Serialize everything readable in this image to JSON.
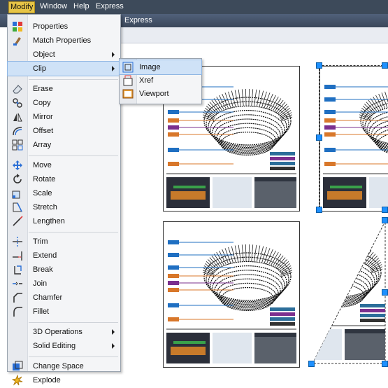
{
  "menubar": {
    "items": [
      {
        "label": "Modify"
      },
      {
        "label": "Window"
      },
      {
        "label": "Help"
      },
      {
        "label": "Express"
      }
    ]
  },
  "ribbon": {
    "tab_label": "Express"
  },
  "modify_menu": {
    "items": [
      {
        "label": "Properties",
        "icon": "properties-icon"
      },
      {
        "label": "Match Properties",
        "icon": "match-properties-icon"
      },
      {
        "label": "Object",
        "icon": "",
        "submenu": true
      },
      {
        "label": "Clip",
        "icon": "",
        "submenu": true,
        "highlighted": true
      },
      {
        "label": "Erase",
        "icon": "eraser-icon"
      },
      {
        "label": "Copy",
        "icon": "copy-icon"
      },
      {
        "label": "Mirror",
        "icon": "mirror-icon"
      },
      {
        "label": "Offset",
        "icon": "offset-icon"
      },
      {
        "label": "Array",
        "icon": "array-icon"
      },
      {
        "label": "Move",
        "icon": "move-icon"
      },
      {
        "label": "Rotate",
        "icon": "rotate-icon"
      },
      {
        "label": "Scale",
        "icon": "scale-icon"
      },
      {
        "label": "Stretch",
        "icon": "stretch-icon"
      },
      {
        "label": "Lengthen",
        "icon": "lengthen-icon"
      },
      {
        "label": "Trim",
        "icon": "trim-icon"
      },
      {
        "label": "Extend",
        "icon": "extend-icon"
      },
      {
        "label": "Break",
        "icon": "break-icon"
      },
      {
        "label": "Join",
        "icon": "join-icon"
      },
      {
        "label": "Chamfer",
        "icon": "chamfer-icon"
      },
      {
        "label": "Fillet",
        "icon": "fillet-icon"
      },
      {
        "label": "3D Operations",
        "icon": "",
        "submenu": true
      },
      {
        "label": "Solid Editing",
        "icon": "",
        "submenu": true
      },
      {
        "label": "Change Space",
        "icon": "change-space-icon"
      },
      {
        "label": "Explode",
        "icon": "explode-icon"
      }
    ]
  },
  "clip_submenu": {
    "items": [
      {
        "label": "Image",
        "icon": "image-clip-icon",
        "highlighted": true
      },
      {
        "label": "Xref",
        "icon": "xref-clip-icon"
      },
      {
        "label": "Viewport",
        "icon": "viewport-clip-icon"
      }
    ]
  },
  "colors": {
    "menubar_bg": "#3d4a5a",
    "menu_highlight": "#cfe2f7",
    "grip": "#1e90ff",
    "active_menu": "#e7c547"
  }
}
